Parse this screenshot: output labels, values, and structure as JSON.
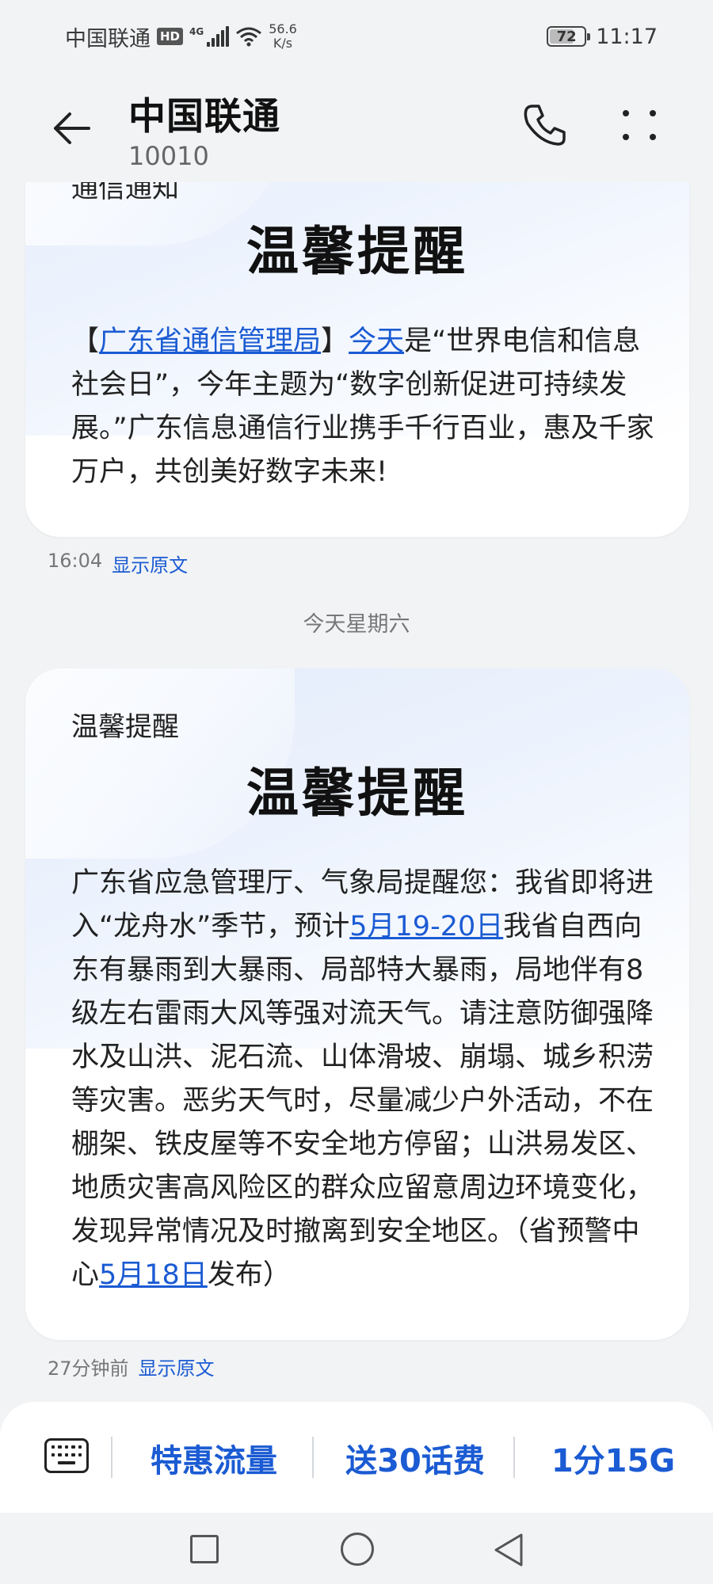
{
  "status_bar": {
    "carrier": "中国联通",
    "hd": "HD",
    "net_type": "4G",
    "net_speed_value": "56.6",
    "net_speed_unit": "K/s",
    "battery": "72",
    "battery_level": 0.72,
    "time": "11:17"
  },
  "header": {
    "contact_name": "中国联通",
    "contact_number": "10010",
    "icons": [
      "back-arrow-icon",
      "phone-icon",
      "more-icon"
    ]
  },
  "messages": [
    {
      "label": "通信通知",
      "heading": "温馨提醒",
      "body": [
        {
          "text": "【"
        },
        {
          "text": "广东省通信管理局",
          "link": true
        },
        {
          "text": "】"
        },
        {
          "text": "今天",
          "link": true
        },
        {
          "text": "是“世界电信和信息社会日”，今年主题为“数字创新促进可持续发展。”广东信息通信行业携手千行百业，惠及千家万户，共创美好数字未来!"
        }
      ],
      "time": "16:04",
      "show_original": "显示原文"
    },
    {
      "label": "温馨提醒",
      "heading": "温馨提醒",
      "body": [
        {
          "text": "广东省应急管理厅、气象局提醒您：我省即将进入“龙舟水”季节，预计"
        },
        {
          "text": "5月19-20日",
          "link": true
        },
        {
          "text": "我省自西向东有暴雨到大暴雨、局部特大暴雨，局地伴有8级左右雷雨大风等强对流天气。请注意防御强降水及山洪、泥石流、山体滑坡、崩塌、城乡积涝等灾害。恶劣天气时，尽量减少户外活动，不在棚架、铁皮屋等不安全地方停留；山洪易发区、地质灾害高风险区的群众应留意周边环境变化，发现异常情况及时撤离到安全地区。（省预警中心"
        },
        {
          "text": "5月18日",
          "link": true
        },
        {
          "text": "发布）"
        }
      ],
      "time": "27分钟前",
      "show_original": "显示原文"
    }
  ],
  "date_separator": "今天星期六",
  "quick_replies": [
    "特惠流量",
    "送30话费",
    "1分15G"
  ],
  "colors": {
    "accent": "#1b5bd3",
    "background": "#f1f3f5",
    "card": "#ffffff"
  }
}
